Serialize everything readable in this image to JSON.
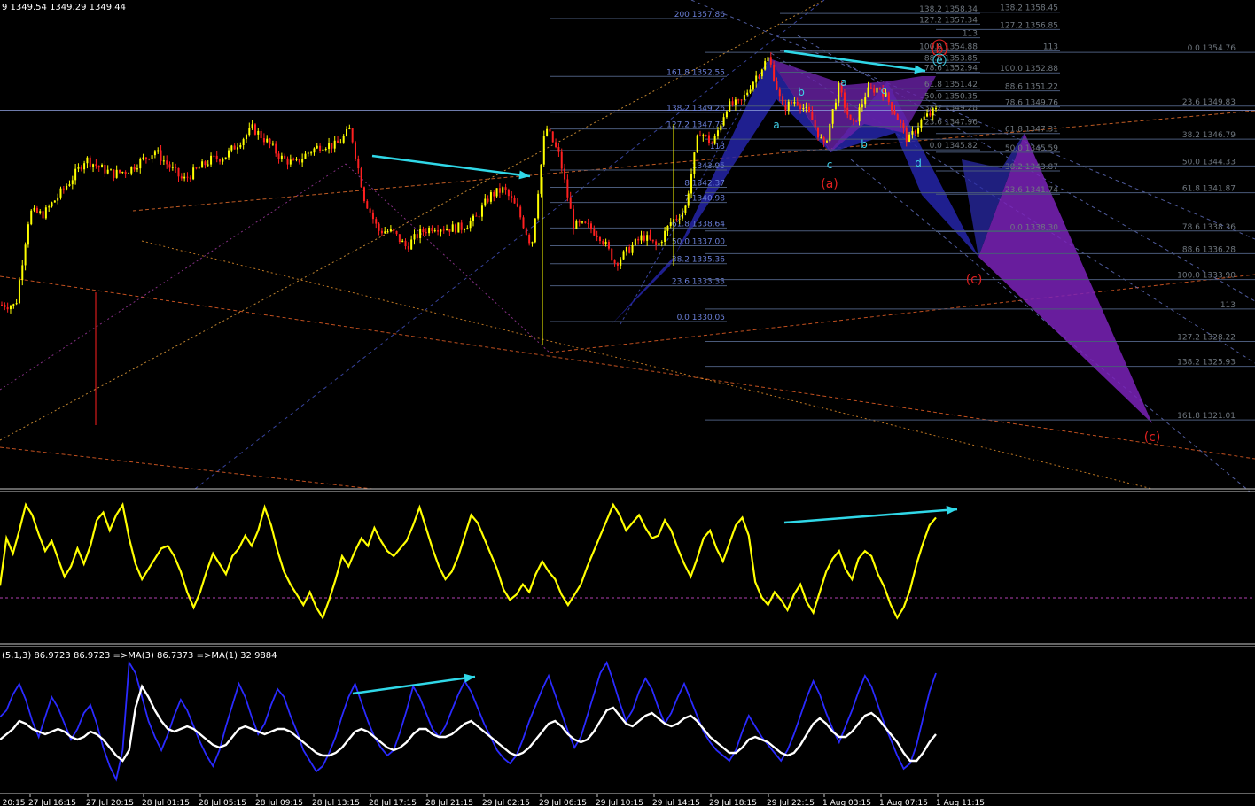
{
  "chart_data": [
    {
      "type": "candlestick",
      "panel": "price",
      "header": "9 1349.54 1349.29 1349.44",
      "colors": {
        "up": "#ffff00",
        "down": "#ff2020",
        "background": "#000000",
        "fib_lines": "#5a6a8a",
        "fib_labels": "#6a7fd8",
        "fib_labels_gray": "#8a8a8a"
      },
      "close_path": [
        1331.6,
        1331.5,
        1340.1,
        1339.9,
        1341.5,
        1343.1,
        1345.0,
        1344.2,
        1343.6,
        1343.9,
        1344.8,
        1345.7,
        1344.3,
        1343.0,
        1344.0,
        1344.9,
        1345.2,
        1346.5,
        1347.8,
        1346.6,
        1345.1,
        1344.5,
        1345.6,
        1346.3,
        1346.2,
        1347.7,
        1341.4,
        1338.4,
        1338.3,
        1336.9,
        1338.2,
        1338.8,
        1338.6,
        1338.7,
        1339.5,
        1341.6,
        1342.2,
        1340.3,
        1337.0,
        1348.0,
        1345.2,
        1338.9,
        1338.8,
        1337.8,
        1335.4,
        1336.7,
        1337.9,
        1336.9,
        1339.2,
        1340.3,
        1347.6,
        1346.3,
        1349.8,
        1350.1,
        1352.4,
        1354.3,
        1349.6,
        1350.4,
        1348.9,
        1346.0,
        1351.6,
        1347.8,
        1351.1,
        1351.6,
        1349.4,
        1346.6,
        1348.6,
        1349.4
      ],
      "fib_left": [
        {
          "label": "200 1357.86",
          "price": 1357.86
        },
        {
          "label": "161.8 1352.55",
          "price": 1352.55
        },
        {
          "label": "138.2 1349.26",
          "price": 1349.26
        },
        {
          "label": "127.2 1347.73",
          "price": 1347.73
        },
        {
          "label": "113",
          "price": 1345.75
        },
        {
          "label": "1343.95",
          "price": 1343.95
        },
        {
          "label": "8 1342.37",
          "price": 1342.37
        },
        {
          "label": "7 1340.98",
          "price": 1340.98
        },
        {
          "label": "61.8 1338.64",
          "price": 1338.64
        },
        {
          "label": "50.0 1337.00",
          "price": 1337.0
        },
        {
          "label": "38.2 1335.36",
          "price": 1335.36
        },
        {
          "label": "23.6 1333.33",
          "price": 1333.33
        },
        {
          "label": "0.0 1330.05",
          "price": 1330.05
        }
      ],
      "fib_mid": [
        {
          "label": "138.2 1358.34",
          "price": 1358.34
        },
        {
          "label": "127.2 1357.34",
          "price": 1357.34
        },
        {
          "label": "113",
          "price": 1356.1
        },
        {
          "label": "100.0 1354.88",
          "price": 1354.88
        },
        {
          "label": "88.6 1353.85",
          "price": 1353.85
        },
        {
          "label": "78.6 1352.94",
          "price": 1352.94
        },
        {
          "label": "61.8 1351.42",
          "price": 1351.42
        },
        {
          "label": "50.0 1350.35",
          "price": 1350.35
        },
        {
          "label": "38.2 1349.28",
          "price": 1349.28
        },
        {
          "label": "23.6 1347.96",
          "price": 1347.96
        },
        {
          "label": "0.0 1345.82",
          "price": 1345.82
        }
      ],
      "fib_right1": [
        {
          "label": "138.2 1358.45",
          "price": 1358.45
        },
        {
          "label": "127.2 1356.85",
          "price": 1356.85
        },
        {
          "label": "113",
          "price": 1354.9
        },
        {
          "label": "100.0 1352.88",
          "price": 1352.88
        },
        {
          "label": "88.6 1351.22",
          "price": 1351.22
        },
        {
          "label": "78.6 1349.76",
          "price": 1349.76
        },
        {
          "label": "61.8 1347.31",
          "price": 1347.31
        },
        {
          "label": "50.0 1345.59",
          "price": 1345.59
        },
        {
          "label": "38.2 1343.87",
          "price": 1343.87
        },
        {
          "label": "23.6 1341.74",
          "price": 1341.74
        },
        {
          "label": "0.0 1338.30",
          "price": 1338.3
        }
      ],
      "fib_right2": [
        {
          "label": "0.0 1354.76",
          "price": 1354.76
        },
        {
          "label": "23.6 1349.83",
          "price": 1349.83
        },
        {
          "label": "38.2 1346.79",
          "price": 1346.79
        },
        {
          "label": "50.0 1344.33",
          "price": 1344.33
        },
        {
          "label": "61.8 1341.87",
          "price": 1341.87
        },
        {
          "label": "78.6 1338.36",
          "price": 1338.36
        },
        {
          "label": "88.6 1336.28",
          "price": 1336.28
        },
        {
          "label": "100.0 1333.90",
          "price": 1333.9
        },
        {
          "label": "113",
          "price": 1331.2
        },
        {
          "label": "127.2 1328.22",
          "price": 1328.22
        },
        {
          "label": "138.2 1325.93",
          "price": 1325.93
        },
        {
          "label": "161.8 1321.01",
          "price": 1321.01
        }
      ],
      "wave_labels_red": [
        "(b)",
        "(a)",
        "(c)",
        "(c)"
      ],
      "wave_labels_cyan": [
        "a",
        "b",
        "a",
        "c",
        "c",
        "b",
        "d",
        "e"
      ],
      "current_price": 1349.44
    },
    {
      "type": "line",
      "panel": "oscillator",
      "series": [
        {
          "color": "#ffff00",
          "values": [
            35,
            72,
            60,
            78,
            98,
            90,
            75,
            62,
            70,
            56,
            42,
            50,
            64,
            52,
            66,
            86,
            92,
            78,
            90,
            98,
            72,
            52,
            40,
            48,
            56,
            64,
            66,
            58,
            46,
            30,
            18,
            30,
            46,
            60,
            52,
            44,
            58,
            64,
            74,
            66,
            78,
            96,
            82,
            62,
            46,
            36,
            28,
            20,
            30,
            18,
            10,
            24,
            40,
            58,
            50,
            62,
            72,
            66,
            80,
            70,
            62,
            58,
            64,
            70,
            82,
            96,
            80,
            64,
            50,
            40,
            46,
            58,
            74,
            90,
            84,
            72,
            60,
            48,
            32,
            24,
            28,
            36,
            30,
            44,
            54,
            46,
            40,
            28,
            20,
            28,
            36,
            50,
            62,
            74,
            86,
            98,
            90,
            78,
            84,
            90,
            80,
            72,
            74,
            86,
            78,
            64,
            52,
            42,
            56,
            72,
            78,
            64,
            54,
            68,
            82,
            88,
            74,
            38,
            26,
            20,
            30,
            24,
            16,
            28,
            36,
            22,
            14,
            30,
            46,
            56,
            62,
            48,
            40,
            56,
            62,
            58,
            44,
            34,
            20,
            10,
            18,
            32,
            52,
            68,
            82,
            88
          ]
        }
      ]
    },
    {
      "type": "line",
      "panel": "stochastic",
      "title": "(5,1,3) 86.9723 86.9723 =>MA(3) 86.7373 =>MA(1) 32.9884",
      "series": [
        {
          "color": "#2a2aff",
          "values": [
            55,
            60,
            72,
            80,
            68,
            52,
            40,
            55,
            70,
            62,
            50,
            38,
            46,
            58,
            64,
            50,
            32,
            18,
            8,
            30,
            96,
            88,
            70,
            52,
            40,
            30,
            42,
            56,
            68,
            60,
            48,
            36,
            26,
            18,
            30,
            48,
            64,
            80,
            70,
            55,
            42,
            50,
            64,
            76,
            70,
            56,
            44,
            30,
            22,
            14,
            18,
            28,
            40,
            56,
            70,
            80,
            66,
            52,
            40,
            32,
            26,
            30,
            44,
            60,
            78,
            70,
            58,
            46,
            40,
            48,
            60,
            72,
            82,
            74,
            62,
            50,
            40,
            30,
            24,
            20,
            26,
            38,
            52,
            64,
            76,
            86,
            72,
            58,
            44,
            32,
            40,
            56,
            72,
            88,
            96,
            82,
            66,
            52,
            60,
            74,
            84,
            76,
            62,
            50,
            58,
            70,
            80,
            68,
            56,
            44,
            36,
            30,
            26,
            22,
            30,
            44,
            56,
            48,
            40,
            34,
            28,
            22,
            30,
            42,
            56,
            70,
            82,
            72,
            58,
            46,
            36,
            48,
            60,
            74,
            86,
            78,
            64,
            50,
            38,
            26,
            16,
            20,
            34,
            54,
            74,
            88
          ]
        },
        {
          "color": "#ffffff",
          "values": [
            38,
            42,
            46,
            52,
            50,
            46,
            44,
            42,
            44,
            46,
            44,
            40,
            38,
            40,
            44,
            42,
            38,
            32,
            26,
            22,
            30,
            62,
            78,
            70,
            60,
            52,
            46,
            44,
            46,
            48,
            46,
            42,
            38,
            34,
            32,
            34,
            40,
            46,
            48,
            46,
            44,
            42,
            44,
            46,
            46,
            44,
            40,
            36,
            32,
            28,
            26,
            26,
            28,
            32,
            38,
            44,
            46,
            44,
            40,
            36,
            32,
            30,
            32,
            36,
            42,
            46,
            46,
            42,
            40,
            40,
            42,
            46,
            50,
            52,
            48,
            44,
            40,
            36,
            32,
            28,
            26,
            28,
            32,
            38,
            44,
            50,
            52,
            48,
            42,
            38,
            36,
            38,
            44,
            52,
            60,
            62,
            56,
            50,
            48,
            52,
            56,
            58,
            54,
            50,
            48,
            50,
            54,
            56,
            52,
            46,
            40,
            36,
            32,
            28,
            28,
            32,
            38,
            40,
            38,
            36,
            32,
            28,
            26,
            28,
            34,
            42,
            50,
            54,
            50,
            44,
            40,
            40,
            44,
            50,
            56,
            58,
            54,
            48,
            42,
            36,
            28,
            22,
            22,
            28,
            36,
            42
          ]
        }
      ]
    }
  ],
  "time_axis": [
    "7 20:15",
    "27 Jul 16:15",
    "27 Jul 20:15",
    "28 Jul 01:15",
    "28 Jul 05:15",
    "28 Jul 09:15",
    "28 Jul 13:15",
    "28 Jul 17:15",
    "28 Jul 21:15",
    "29 Jul 02:15",
    "29 Jul 06:15",
    "29 Jul 10:15",
    "29 Jul 14:15",
    "29 Jul 18:15",
    "29 Jul 22:15",
    "1 Aug 03:15",
    "1 Aug 07:15",
    "1 Aug 11:15"
  ]
}
